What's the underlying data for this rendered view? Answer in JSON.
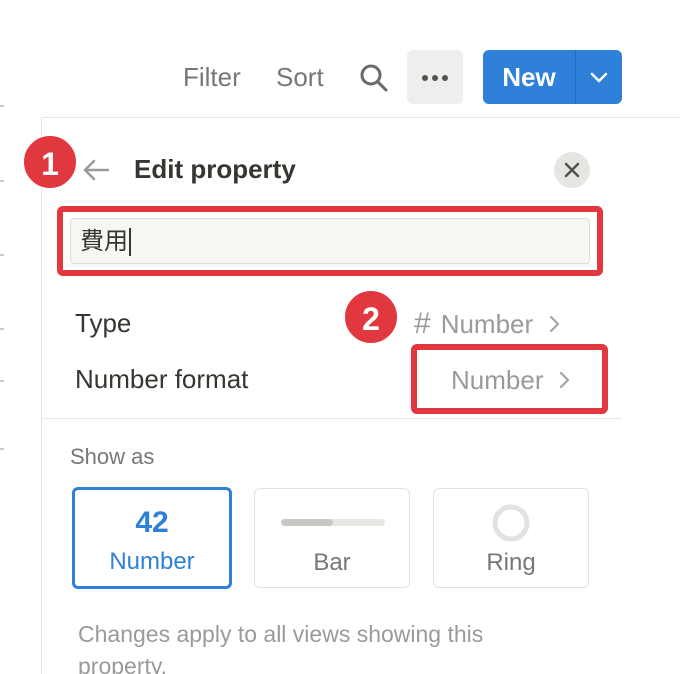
{
  "toolbar": {
    "filter_label": "Filter",
    "sort_label": "Sort",
    "search_icon": "search-icon",
    "more_icon": "more-horizontal-icon",
    "new_label": "New",
    "new_dropdown_icon": "chevron-down-icon"
  },
  "panel": {
    "back_icon": "arrow-left-icon",
    "title": "Edit property",
    "close_icon": "close-icon",
    "property_name": "費用",
    "type": {
      "label": "Type",
      "icon": "hash-icon",
      "value": "Number"
    },
    "number_format": {
      "label": "Number format",
      "value": "Number"
    },
    "show_as": {
      "label": "Show as",
      "options": [
        {
          "preview": "42",
          "label": "Number",
          "selected": true
        },
        {
          "preview_icon": "bar-preview-icon",
          "label": "Bar",
          "fill_fraction": 0.5,
          "selected": false
        },
        {
          "preview_icon": "ring-preview-icon",
          "label": "Ring",
          "selected": false
        }
      ]
    },
    "footnote": "Changes apply to all views showing this property."
  },
  "annotations": {
    "badge_1": "1",
    "badge_2": "2",
    "highlight_color": "#e0383e"
  },
  "colors": {
    "accent": "#2f80d8",
    "text": "#37352f",
    "muted": "#9b9a97"
  }
}
